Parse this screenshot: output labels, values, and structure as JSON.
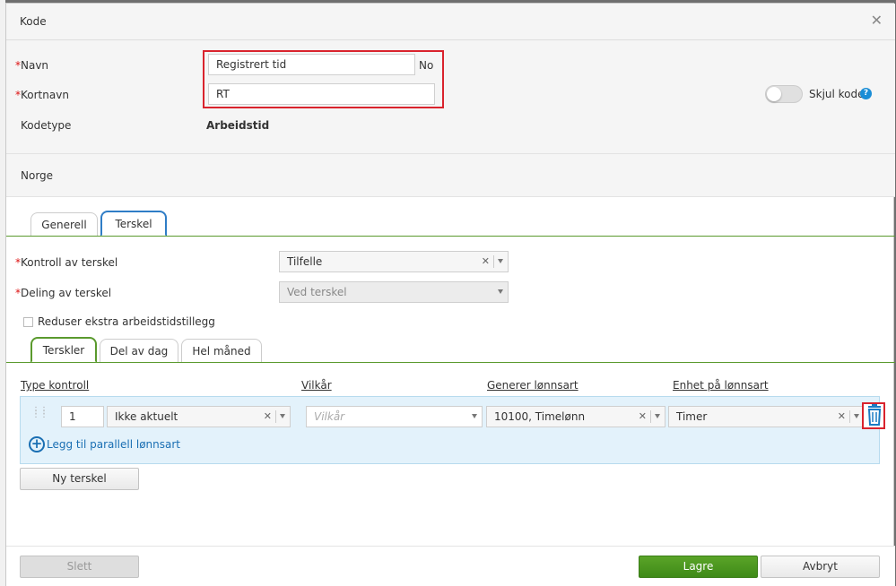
{
  "dialog": {
    "title": "Kode"
  },
  "form": {
    "navn": {
      "label": "Navn",
      "value": "Registrert tid",
      "lang": "No"
    },
    "kortnavn": {
      "label": "Kortnavn",
      "value": "RT"
    },
    "kodetype": {
      "label": "Kodetype",
      "value": "Arbeidstid"
    },
    "skjul_kode": {
      "label": "Skjul kode",
      "on": false
    },
    "country": "Norge"
  },
  "tabs": [
    "Generell",
    "Terskel"
  ],
  "active_tab": "Terskel",
  "terskel": {
    "kontroll": {
      "label": "Kontroll av terskel",
      "value": "Tilfelle"
    },
    "deling": {
      "label": "Deling av terskel",
      "value": "Ved terskel"
    },
    "reduser": {
      "label": "Reduser ekstra arbeidstidstillegg",
      "checked": false
    }
  },
  "subtabs": [
    "Terskler",
    "Del av dag",
    "Hel måned"
  ],
  "active_subtab": "Terskler",
  "columns": {
    "type_kontroll": "Type kontroll",
    "vilkar": "Vilkår",
    "generer": "Generer lønnsart",
    "enhet": "Enhet på lønnsart"
  },
  "row": {
    "number": "1",
    "type": "Ikke aktuelt",
    "vilkar_placeholder": "Vilkår",
    "lonnsart": "10100, Timelønn",
    "enhet": "Timer",
    "add_parallel": "Legg til parallell lønnsart"
  },
  "buttons": {
    "ny_terskel": "Ny terskel",
    "slett": "Slett",
    "lagre": "Lagre",
    "avbryt": "Avbryt"
  },
  "colors": {
    "accent_green": "#4a9420",
    "accent_blue": "#2f7dc6",
    "highlight_red": "#d9232d",
    "panel_blue": "#e3f2fb"
  }
}
